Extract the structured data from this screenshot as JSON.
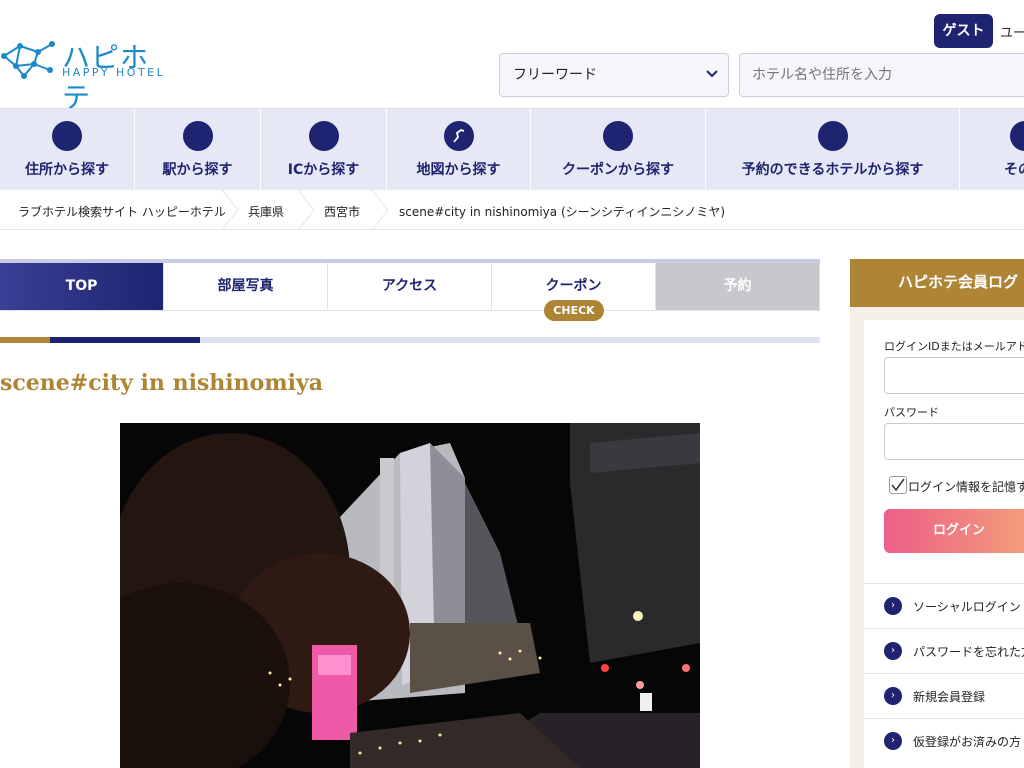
{
  "header": {
    "logo_jp": "ハピホテ",
    "logo_en": "HAPPY HOTEL",
    "guest_label": "ゲスト",
    "user_label": "ユー",
    "search_select": "フリーワード",
    "search_placeholder": "ホテル名や住所を入力"
  },
  "nav": {
    "items": [
      {
        "label": "住所から探す",
        "icon": "location-icon"
      },
      {
        "label": "駅から探す",
        "icon": "train-icon"
      },
      {
        "label": "ICから探す",
        "icon": "highway-icon"
      },
      {
        "label": "地図から探す",
        "icon": "map-icon"
      },
      {
        "label": "クーポンから探す",
        "icon": "coupon-icon"
      },
      {
        "label": "予約のできるホテルから探す",
        "icon": "reserve-icon"
      },
      {
        "label": "その他",
        "icon": "more-icon"
      }
    ]
  },
  "breadcrumb": {
    "items": [
      "ラブホテル検索サイト ハッピーホテル",
      "兵庫県",
      "西宮市",
      "scene#city in nishinomiya (シーンシティインニシノミヤ)"
    ]
  },
  "tabs": {
    "items": [
      "TOP",
      "部屋写真",
      "アクセス",
      "クーポン",
      "予約"
    ],
    "check_badge": "CHECK"
  },
  "hotel": {
    "name": "scene#city in nishinomiya"
  },
  "sidebar": {
    "title": "ハピホテ会員ログ",
    "id_label": "ログインIDまたはメールアドレ",
    "password_label": "パスワード",
    "remember_label": "ログイン情報を記憶す",
    "login_button": "ログイン",
    "links": [
      "ソーシャルログイン",
      "パスワードを忘れた方",
      "新規会員登録",
      "仮登録がお済みの方"
    ]
  },
  "colors": {
    "navy": "#1e2470",
    "gold": "#ad8535",
    "nav_bg": "#e7e8f5",
    "logo_blue": "#1c8ac9"
  }
}
